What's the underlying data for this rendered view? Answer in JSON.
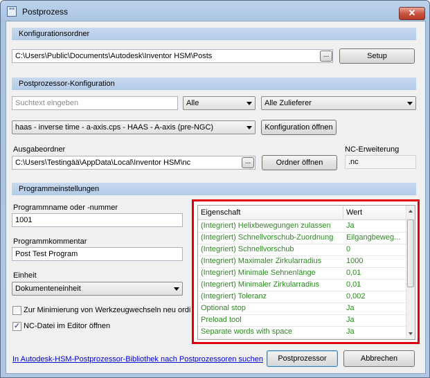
{
  "window": {
    "title": "Postprozess",
    "close_glyph": "✕"
  },
  "config_folder": {
    "heading": "Konfigurationsordner",
    "path": "C:\\Users\\Public\\Documents\\Autodesk\\Inventor HSM\\Posts",
    "browse_label": "...",
    "setup_label": "Setup"
  },
  "post_config": {
    "heading": "Postprozessor-Konfiguration",
    "search_placeholder": "Suchtext eingeben",
    "filter_all": "Alle",
    "filter_vendor": "Alle Zulieferer",
    "selected_post": "haas - inverse time - a-axis.cps - HAAS - A-axis (pre-NGC)",
    "open_config_label": "Konfiguration öffnen",
    "output_folder_label": "Ausgabeordner",
    "output_folder_path": "C:\\Users\\Testingää\\AppData\\Local\\Inventor HSM\\nc",
    "output_browse_label": "...",
    "open_folder_label": "Ordner öffnen",
    "nc_ext_label": "NC-Erweiterung",
    "nc_ext_value": ".nc"
  },
  "program_settings": {
    "heading": "Programmeinstellungen",
    "name_label": "Programmname oder -nummer",
    "name_value": "1001",
    "comment_label": "Programmkommentar",
    "comment_value": "Post Test Program",
    "unit_label": "Einheit",
    "unit_value": "Dokumenteneinheit",
    "minimize_tool_changes_label": "Zur Minimierung von Werkzeugwechseln neu ordi",
    "minimize_tool_changes_checked": false,
    "open_nc_label": "NC-Datei im Editor öffnen",
    "open_nc_checked": true
  },
  "properties": {
    "columns": [
      "Eigenschaft",
      "Wert"
    ],
    "rows": [
      {
        "name": "(Integriert) Helixbewegungen zulassen",
        "value": "Ja"
      },
      {
        "name": "(Integriert) Schnellvorschub-Zuordnung",
        "value": "Eilgangbeweg..."
      },
      {
        "name": "(Integriert) Schnellvorschub",
        "value": "0"
      },
      {
        "name": "(Integriert) Maximaler Zirkularradius",
        "value": "1000"
      },
      {
        "name": "(Integriert) Minimale Sehnenlänge",
        "value": "0,01"
      },
      {
        "name": "(Integriert) Minimaler Zirkularradius",
        "value": "0,01"
      },
      {
        "name": "(Integriert) Toleranz",
        "value": "0,002"
      },
      {
        "name": "Optional stop",
        "value": "Ja"
      },
      {
        "name": "Preload tool",
        "value": "Ja"
      },
      {
        "name": "Separate words with space",
        "value": "Ja"
      }
    ],
    "highlight_color": "#e0000b",
    "value_color": "#2b8a1f"
  },
  "footer": {
    "library_link": "In Autodesk-HSM-Postprozessor-Bibliothek nach Postprozessoren suchen",
    "post_button": "Postprozessor",
    "cancel_button": "Abbrechen"
  }
}
